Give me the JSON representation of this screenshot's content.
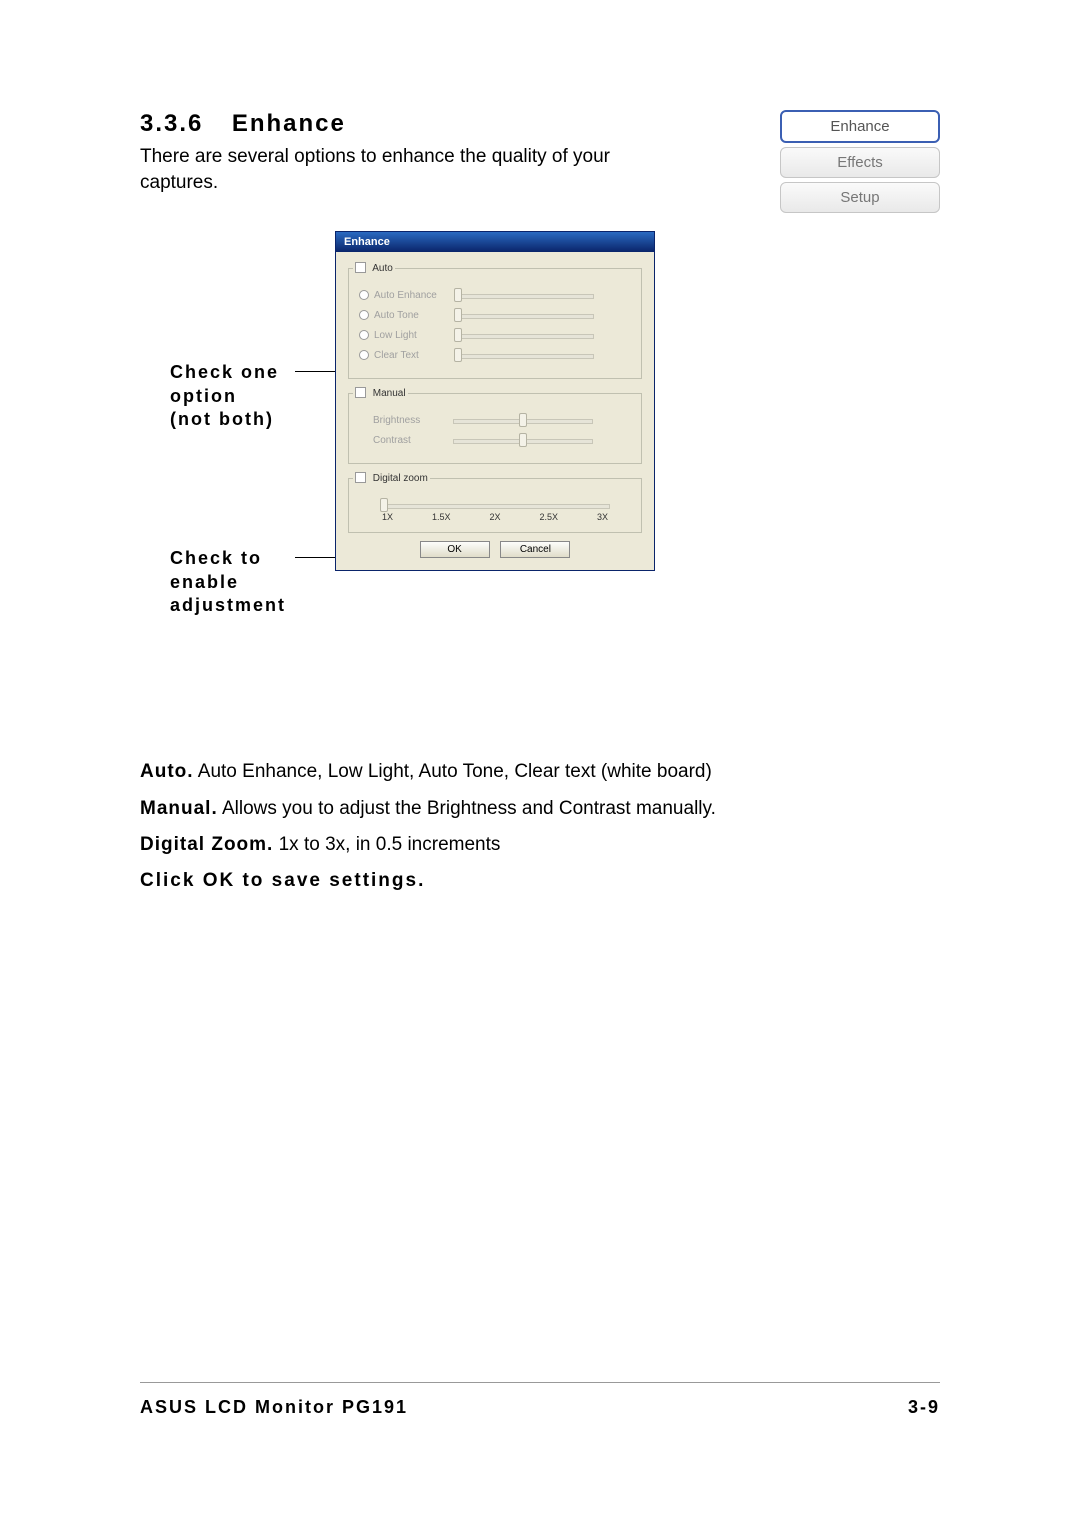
{
  "section": {
    "number": "3.3.6",
    "title": "Enhance"
  },
  "intro": "There are several options to enhance the quality of your captures.",
  "tabs": {
    "enhance": "Enhance",
    "effects": "Effects",
    "setup": "Setup"
  },
  "callouts": {
    "check_one": "Check one\noption\n(not both)",
    "check_enable": "Check to\nenable\nadjustment"
  },
  "dialog": {
    "title": "Enhance",
    "auto": {
      "legend": "Auto",
      "options": {
        "auto_enhance": "Auto Enhance",
        "auto_tone": "Auto Tone",
        "low_light": "Low Light",
        "clear_text": "Clear Text"
      }
    },
    "manual": {
      "legend": "Manual",
      "brightness_label": "Brightness",
      "contrast_label": "Contrast"
    },
    "zoom": {
      "legend": "Digital zoom",
      "ticks": {
        "t1": "1X",
        "t15": "1.5X",
        "t2": "2X",
        "t25": "2.5X",
        "t3": "3X"
      }
    },
    "buttons": {
      "ok": "OK",
      "cancel": "Cancel"
    }
  },
  "desc": {
    "auto_bold": "Auto.",
    "auto_rest": " Auto Enhance, Low Light, Auto Tone, Clear text (white board)",
    "manual_bold": "Manual.",
    "manual_rest": " Allows you to adjust the Brightness and Contrast manually.",
    "zoom_bold": "Digital Zoom.",
    "zoom_rest": " 1x to 3x, in 0.5 increments",
    "save": "Click OK to save settings."
  },
  "footer": {
    "product": "ASUS LCD Monitor PG191",
    "page": "3-9"
  }
}
